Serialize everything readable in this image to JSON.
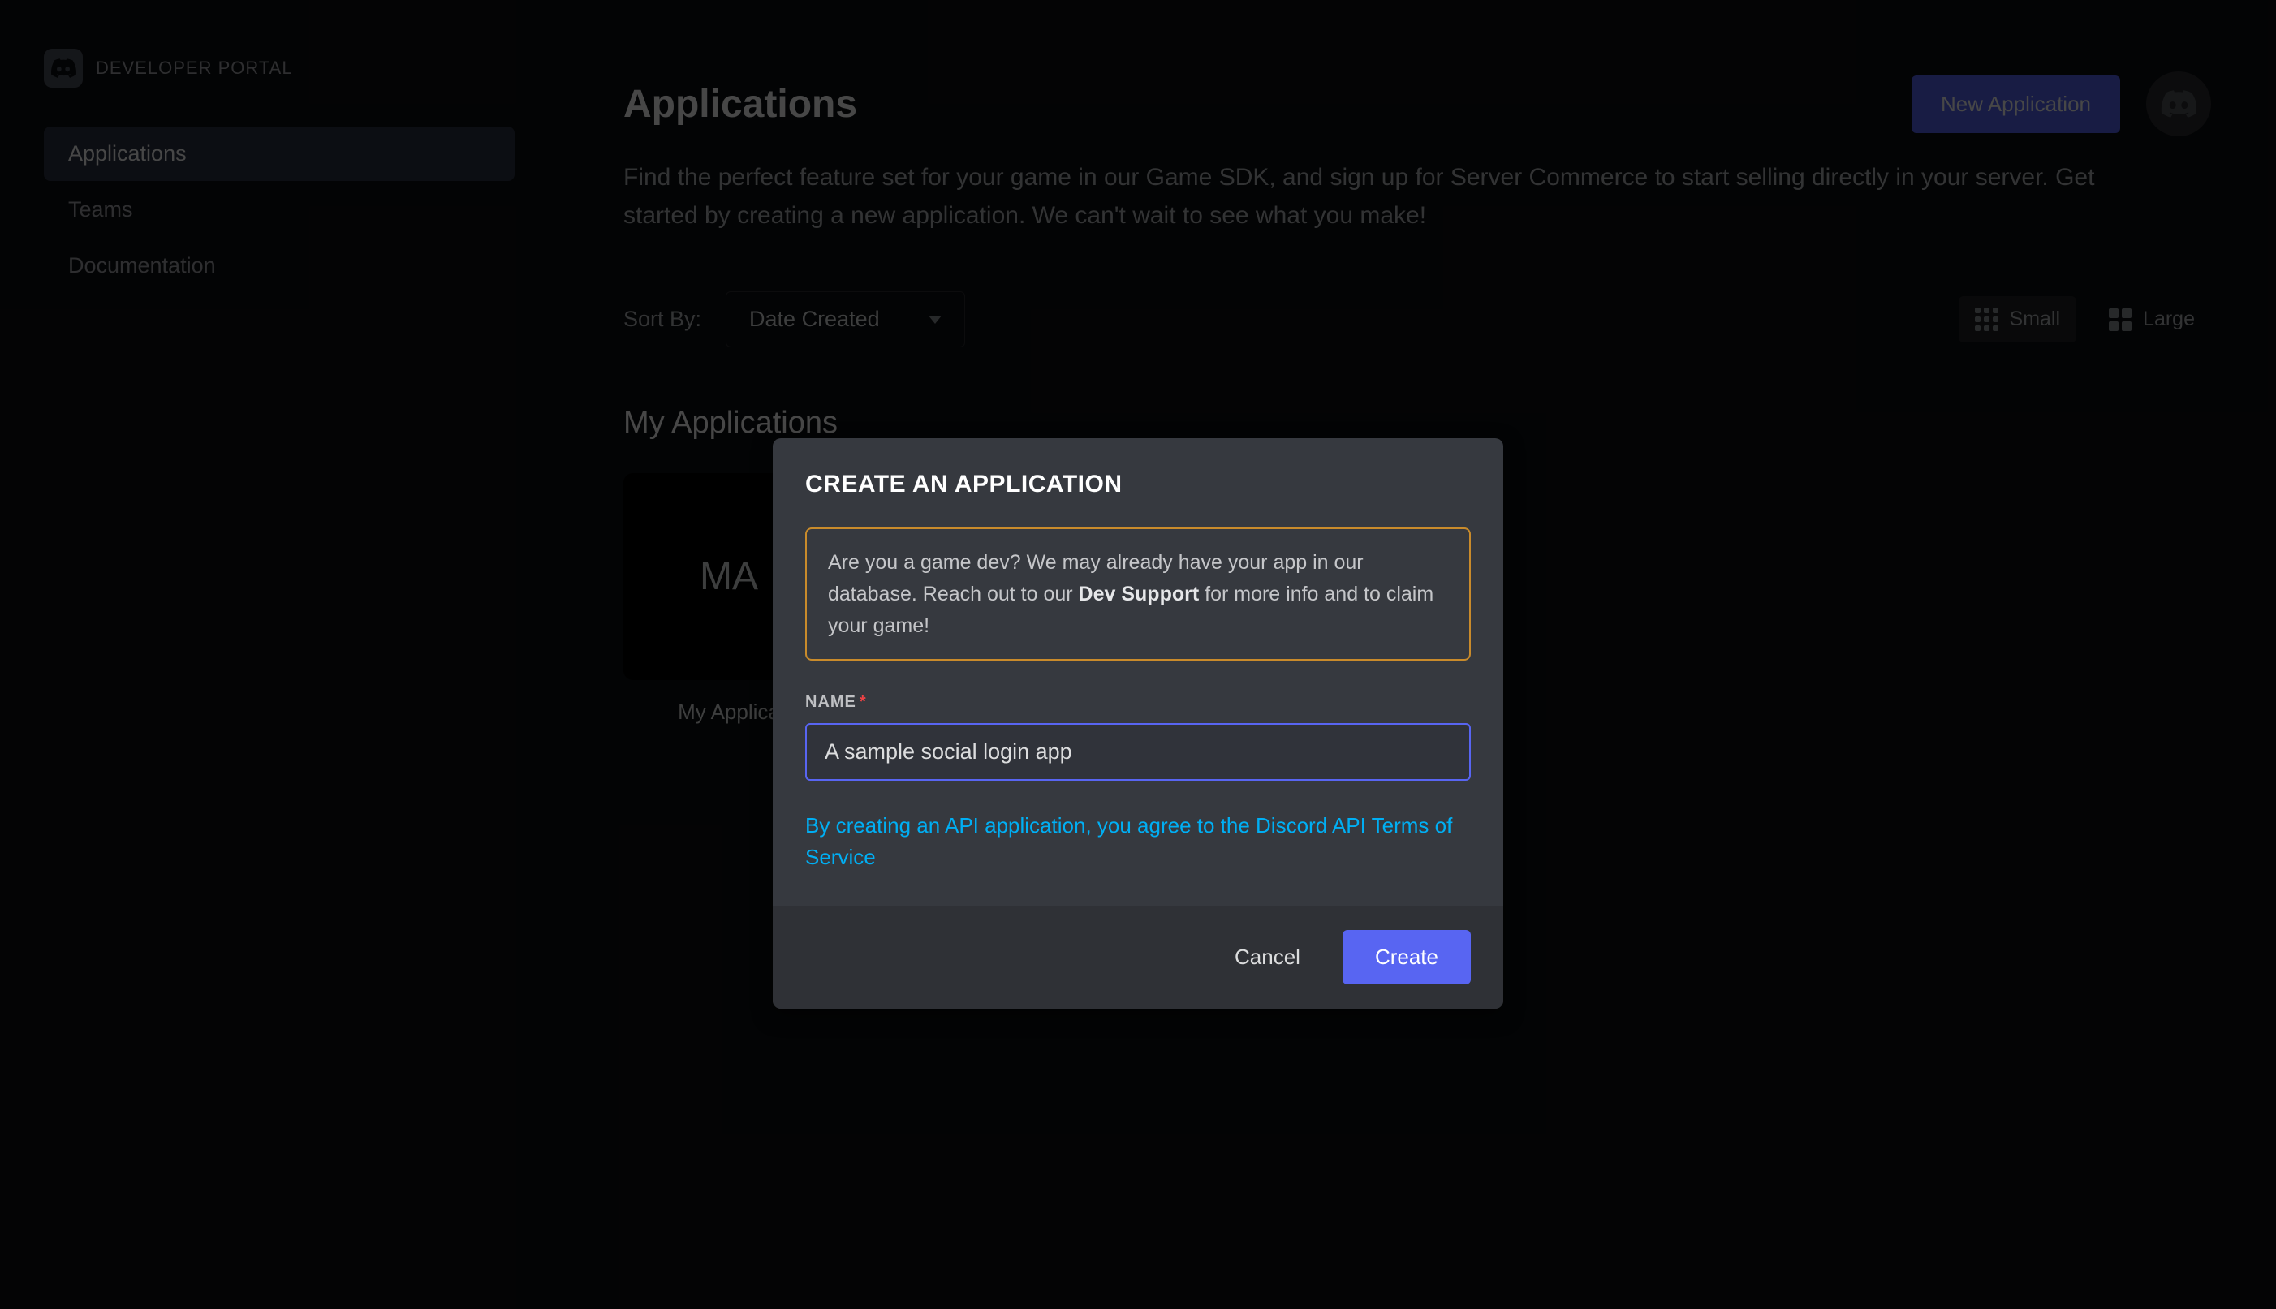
{
  "sidebar": {
    "brand": "DEVELOPER PORTAL",
    "items": [
      {
        "label": "Applications",
        "active": true
      },
      {
        "label": "Teams",
        "active": false
      },
      {
        "label": "Documentation",
        "active": false
      }
    ]
  },
  "header": {
    "title": "Applications",
    "new_app_button": "New Application",
    "subtitle": "Find the perfect feature set for your game in our Game SDK, and sign up for Server Commerce to start selling directly in your server. Get started by creating a new application. We can't wait to see what you make!"
  },
  "sort": {
    "label": "Sort By:",
    "selected": "Date Created",
    "view_small": "Small",
    "view_large": "Large"
  },
  "applications_section": {
    "title": "My Applications",
    "items": [
      {
        "thumb_text": "MA",
        "name": "My Applica"
      }
    ]
  },
  "modal": {
    "title": "CREATE AN APPLICATION",
    "info_prefix": "Are you a game dev? We may already have your app in our database. Reach out to our ",
    "info_strong": "Dev Support",
    "info_suffix": " for more info and to claim your game!",
    "name_label": "NAME",
    "name_required": "*",
    "name_value": "A sample social login app",
    "tos_text": "By creating an API application, you agree to the Discord API Terms of Service",
    "cancel_button": "Cancel",
    "create_button": "Create"
  }
}
